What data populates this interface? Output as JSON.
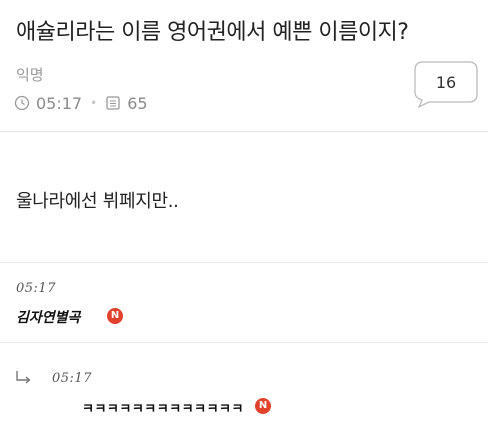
{
  "post": {
    "title": "애슐리라는 이름 영어권에서 예쁜 이름이지?",
    "author": "익명",
    "time": "05:17",
    "views": "65",
    "comment_count": "16",
    "body": "울나라에선 뷔페지만.."
  },
  "comments": [
    {
      "time": "05:17",
      "author": "김자연별곡",
      "badge": "N"
    }
  ],
  "reply": {
    "time": "05:17",
    "text": "ㅋㅋㅋㅋㅋㅋㅋㅋㅋㅋㅋㅋㅋ",
    "badge": "N"
  },
  "icons": [
    "clock-icon",
    "view-count-icon",
    "reply-arrow-icon",
    "new-badge-icon",
    "comment-bubble-icon"
  ],
  "colors": {
    "badge": "#e2412c",
    "meta_text": "#8a8a8a"
  }
}
